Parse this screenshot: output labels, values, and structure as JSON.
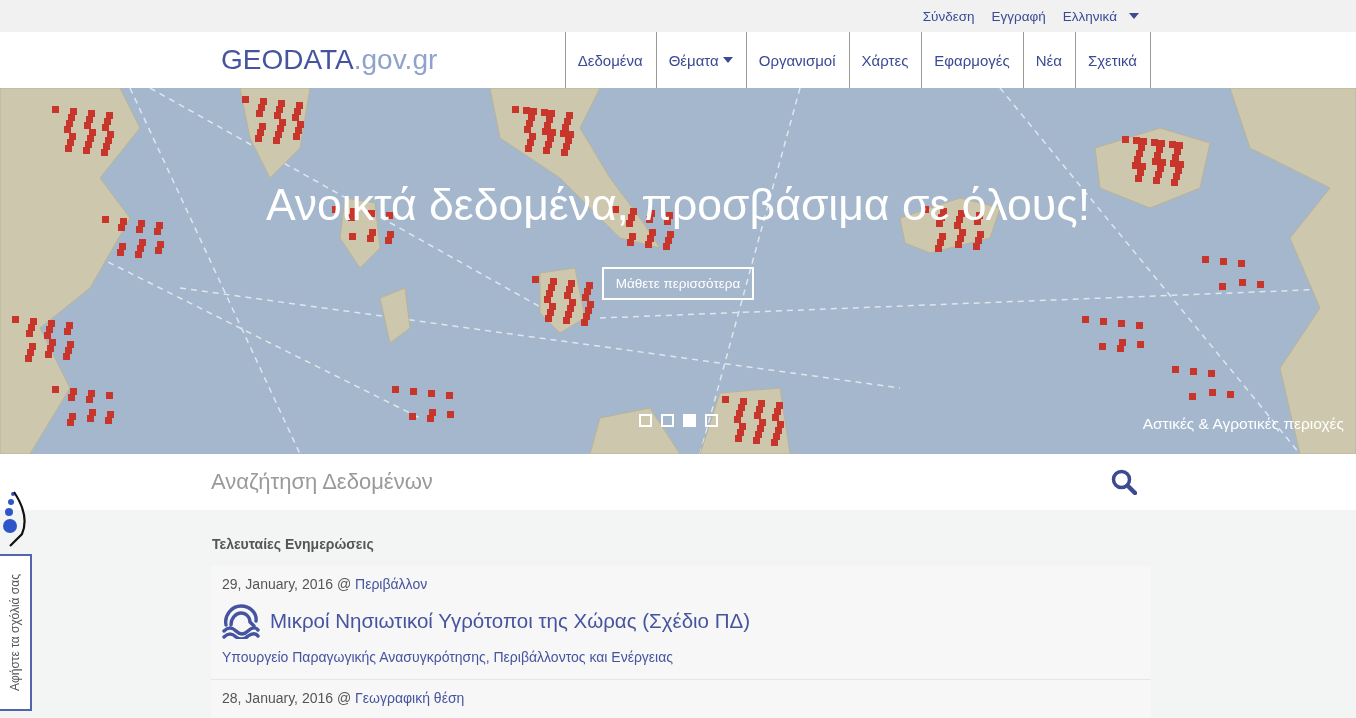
{
  "top_links": [
    {
      "label": "Σύνδεση"
    },
    {
      "label": "Εγγραφή"
    }
  ],
  "language": {
    "label": "Ελληνικά"
  },
  "logo": {
    "main": "GEODATA",
    "suffix": ".gov.gr"
  },
  "nav": [
    {
      "label": "Δεδομένα",
      "dropdown": false
    },
    {
      "label": "Θέματα",
      "dropdown": true
    },
    {
      "label": "Οργανισμοί",
      "dropdown": false
    },
    {
      "label": "Χάρτες",
      "dropdown": false
    },
    {
      "label": "Εφαρμογές",
      "dropdown": false
    },
    {
      "label": "Νέα",
      "dropdown": false
    },
    {
      "label": "Σχετικά",
      "dropdown": false
    }
  ],
  "hero": {
    "headline": "Ανοικτά δεδομένα, προσβάσιμα σε όλους!",
    "button": "Μάθετε περισσότερα",
    "caption": "Αστικές & Αγροτικές περιοχές",
    "slides": [
      {
        "selected": false
      },
      {
        "selected": false
      },
      {
        "selected": true
      },
      {
        "selected": false
      }
    ]
  },
  "search": {
    "placeholder": "Αναζήτηση Δεδομένων"
  },
  "updates": {
    "heading": "Τελευταίες Ενημερώσεις",
    "items": [
      {
        "date": "29, January, 2016 @",
        "category": "Περιβάλλον",
        "title": "Μικροί Νησιωτικοί Υγρότοποι της Χώρας (Σχέδιο ΠΔ)",
        "organization": "Υπουργείο Παραγωγικής Ανασυγκρότησης, Περιβάλλοντος και Ενέργειας"
      },
      {
        "date": "28, January, 2016 @",
        "category": "Γεωγραφική θέση"
      }
    ]
  },
  "feedback": {
    "label": "Αφήστε τα σχόλιά σας"
  }
}
